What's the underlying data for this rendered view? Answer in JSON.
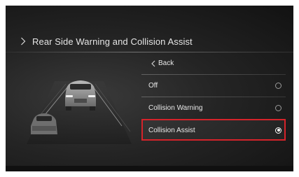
{
  "header": {
    "title": "Rear Side Warning and Collision Assist"
  },
  "menu": {
    "back_label": "Back",
    "options": [
      {
        "label": "Off",
        "selected": false
      },
      {
        "label": "Collision Warning",
        "selected": false
      },
      {
        "label": "Collision Assist",
        "selected": true
      }
    ]
  },
  "colors": {
    "highlight": "#d5232a",
    "background": "#1c1c1c",
    "text": "#e8e8e8"
  },
  "icons": {
    "header": "chevron-right-icon",
    "back": "chevron-left-icon",
    "radio": "radio-button-icon"
  }
}
